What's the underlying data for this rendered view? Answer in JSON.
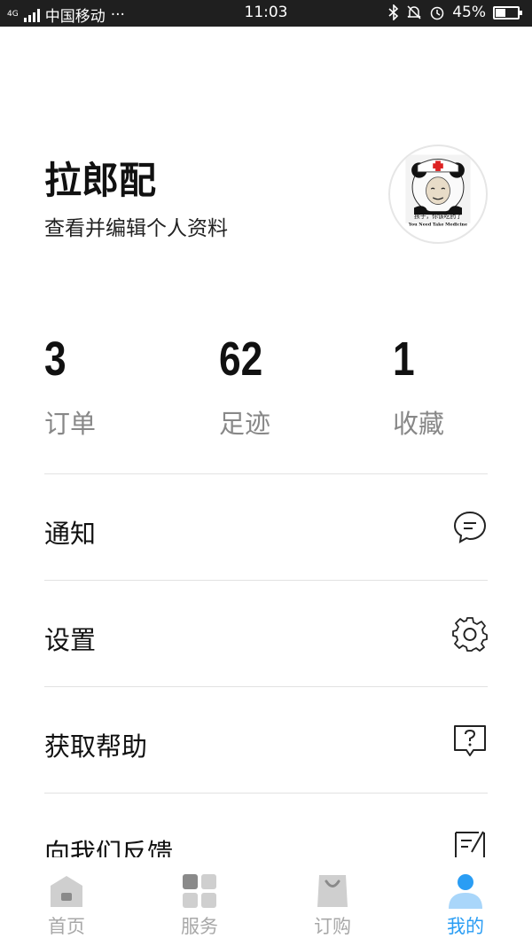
{
  "status_bar": {
    "network": "4G",
    "carrier": "中国移动",
    "dots": "···",
    "time": "11:03",
    "battery": "45%"
  },
  "profile": {
    "name": "拉郎配",
    "subtitle": "查看并编辑个人资料",
    "avatar_caption": "孩子，你该吃药了",
    "avatar_caption_en": "You Need Take Medicine"
  },
  "stats": [
    {
      "value": "3",
      "label": "订单"
    },
    {
      "value": "62",
      "label": "足迹"
    },
    {
      "value": "1",
      "label": "收藏"
    }
  ],
  "menu": [
    {
      "label": "通知",
      "icon": "chat-bubble-icon"
    },
    {
      "label": "设置",
      "icon": "gear-icon"
    },
    {
      "label": "获取帮助",
      "icon": "help-question-icon"
    },
    {
      "label": "向我们反馈",
      "icon": "feedback-edit-icon"
    }
  ],
  "bottom_nav": [
    {
      "label": "首页",
      "icon": "home-icon",
      "active": false
    },
    {
      "label": "服务",
      "icon": "grid-icon",
      "active": false
    },
    {
      "label": "订购",
      "icon": "shopping-bag-icon",
      "active": false
    },
    {
      "label": "我的",
      "icon": "person-icon",
      "active": true
    }
  ],
  "colors": {
    "active": "#2a9df4",
    "inactive": "#a8a8a8",
    "divider": "#e2e2e2"
  }
}
